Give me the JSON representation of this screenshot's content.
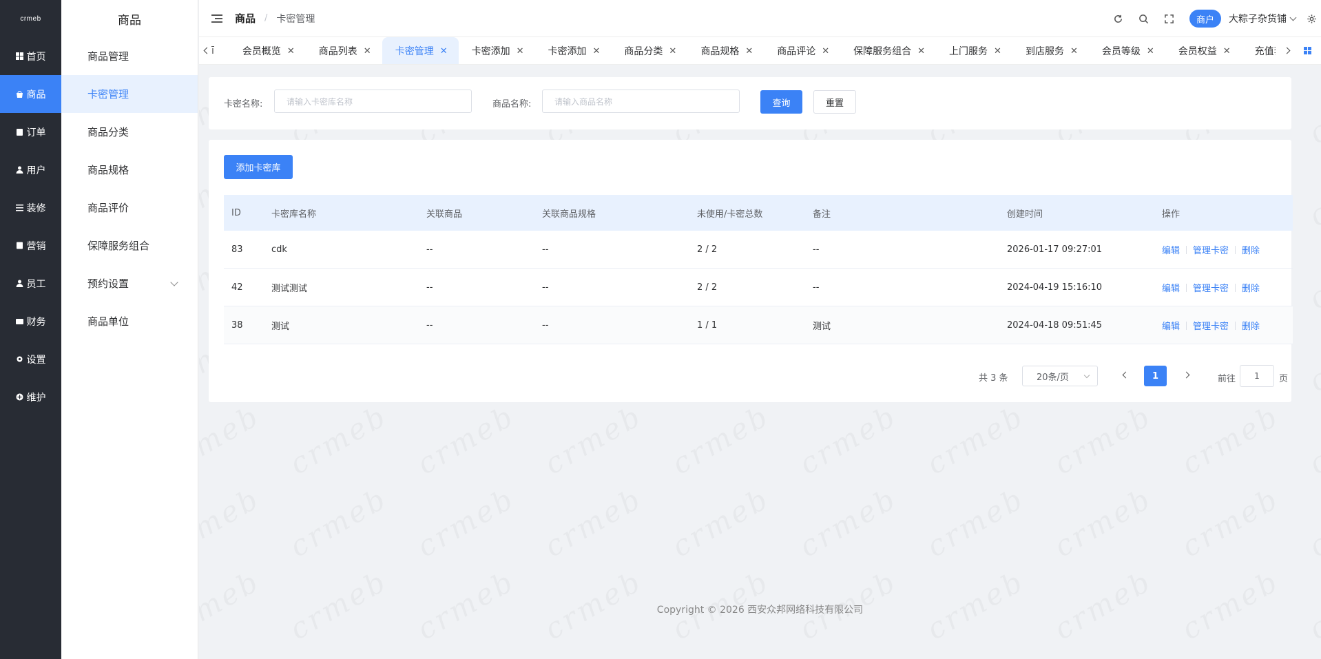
{
  "logo": "crmeb",
  "nav": [
    {
      "label": "首页",
      "icon": "grid-icon"
    },
    {
      "label": "商品",
      "icon": "bag-icon",
      "active": true
    },
    {
      "label": "订单",
      "icon": "clipboard-icon"
    },
    {
      "label": "用户",
      "icon": "user-icon"
    },
    {
      "label": "装修",
      "icon": "sliders-icon"
    },
    {
      "label": "营销",
      "icon": "book-icon"
    },
    {
      "label": "员工",
      "icon": "person-icon"
    },
    {
      "label": "财务",
      "icon": "wallet-icon"
    },
    {
      "label": "设置",
      "icon": "gear-icon"
    },
    {
      "label": "维护",
      "icon": "plus-circle-icon"
    }
  ],
  "submenu": {
    "title": "商品",
    "items": [
      "商品管理",
      "卡密管理",
      "商品分类",
      "商品规格",
      "商品评价",
      "保障服务组合",
      "预约设置",
      "商品单位"
    ]
  },
  "header": {
    "breadcrumb_root": "商品",
    "breadcrumb_sep": "/",
    "breadcrumb_current": "卡密管理",
    "merchant_badge": "商户",
    "shop_name": "大粽子杂货铺"
  },
  "tabs": {
    "first": "ī",
    "items": [
      "会员概览",
      "商品列表",
      "卡密管理",
      "卡密添加",
      "卡密添加",
      "商品分类",
      "商品规格",
      "商品评论",
      "保障服务组合",
      "上门服务",
      "到店服务",
      "会员等级",
      "会员权益",
      "充值套餐"
    ],
    "active_index": 2
  },
  "filter": {
    "card_name_label": "卡密名称:",
    "card_name_placeholder": "请输入卡密库名称",
    "product_name_label": "商品名称:",
    "product_name_placeholder": "请输入商品名称",
    "query_label": "查询",
    "reset_label": "重置"
  },
  "list": {
    "add_label": "添加卡密库",
    "columns": [
      "ID",
      "卡密库名称",
      "关联商品",
      "关联商品规格",
      "未使用/卡密总数",
      "备注",
      "创建时间",
      "操作"
    ],
    "rows": [
      {
        "id": "83",
        "name": "cdk",
        "product": "--",
        "spec": "--",
        "count": "2 / 2",
        "remark": "--",
        "created": "2026-01-17 09:27:01"
      },
      {
        "id": "42",
        "name": "测试测试",
        "product": "--",
        "spec": "--",
        "count": "2 / 2",
        "remark": "--",
        "created": "2024-04-19 15:16:10"
      },
      {
        "id": "38",
        "name": "测试",
        "product": "--",
        "spec": "--",
        "count": "1 / 1",
        "remark": "测试",
        "created": "2024-04-18 09:51:45"
      }
    ],
    "actions": {
      "edit": "编辑",
      "manage": "管理卡密",
      "delete": "删除"
    }
  },
  "pagination": {
    "total": "共 3 条",
    "page_size": "20条/页",
    "current_page": "1",
    "goto_label": "前往",
    "goto_value": "1",
    "page_suffix": "页"
  },
  "footer": "Copyright © 2026 西安众邦网络科技有限公司",
  "colors": {
    "primary": "#3b82f6",
    "rail": "#282c34"
  }
}
